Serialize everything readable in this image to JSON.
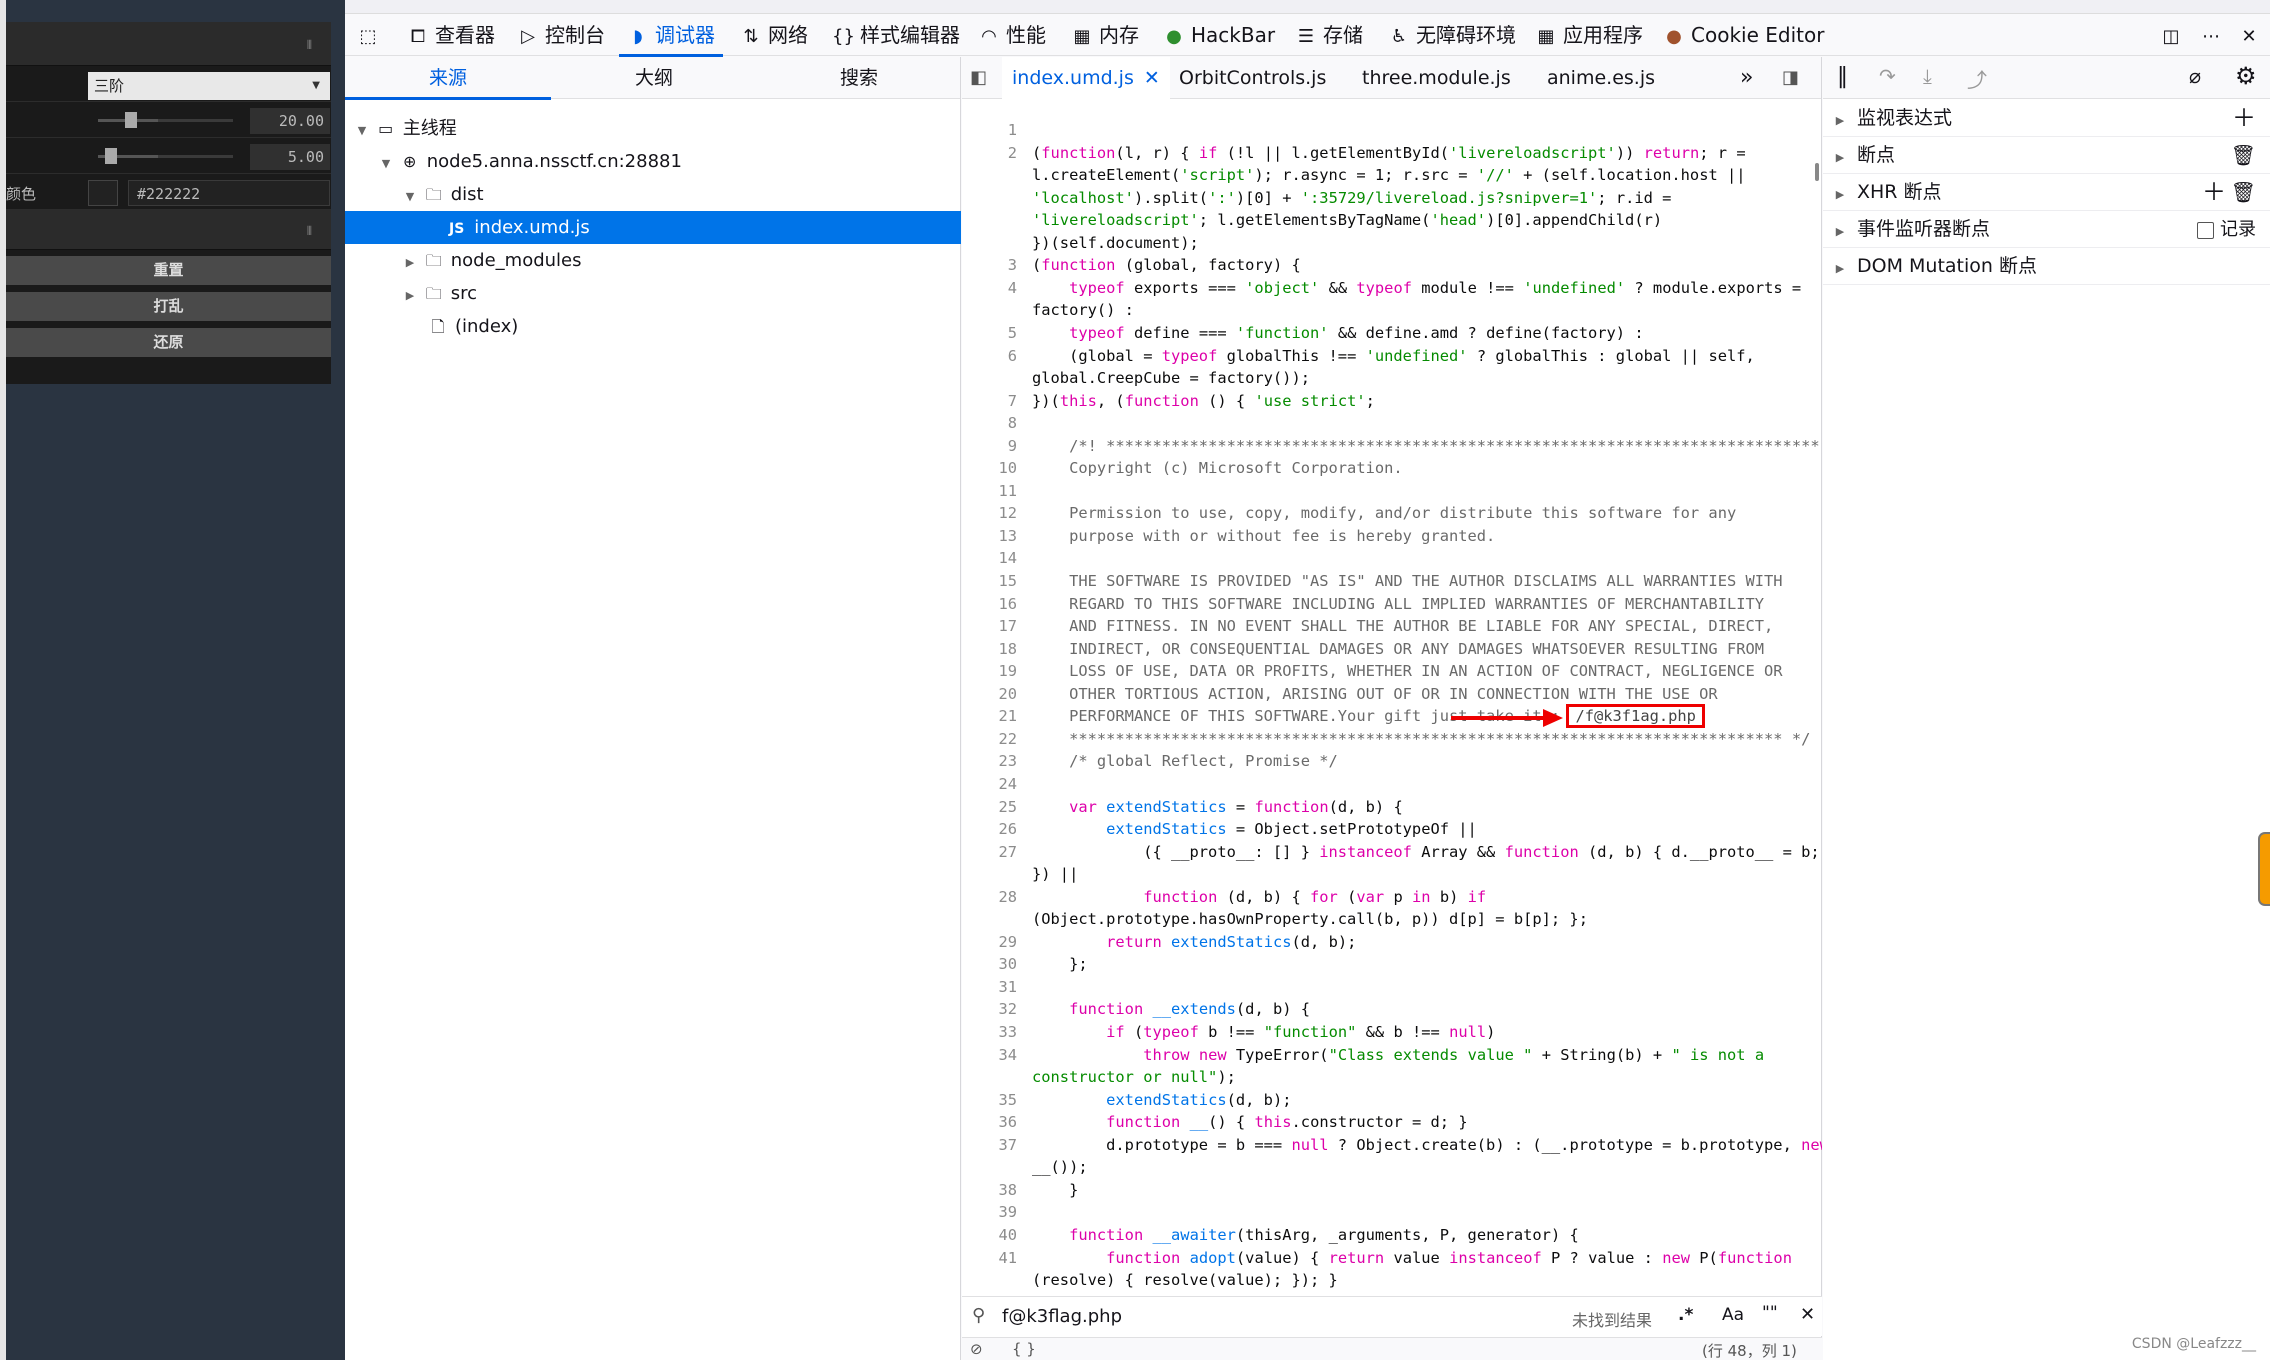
{
  "app": {
    "select_value": "三阶",
    "slider1_value": "20.00",
    "slider1_fraction": 0.2,
    "slider2_value": "5.00",
    "slider2_fraction": 0.05,
    "color_label": "颜色",
    "color_value": "#222222",
    "buttons": [
      "重置",
      "打乱",
      "还原"
    ]
  },
  "toolbar": {
    "items": [
      {
        "label": "查看器",
        "icon": "inspector-icon"
      },
      {
        "label": "控制台",
        "icon": "console-icon"
      },
      {
        "label": "调试器",
        "icon": "debugger-icon"
      },
      {
        "label": "网络",
        "icon": "network-icon"
      },
      {
        "label": "样式编辑器",
        "icon": "style-editor-icon"
      },
      {
        "label": "性能",
        "icon": "performance-icon"
      },
      {
        "label": "内存",
        "icon": "memory-icon"
      },
      {
        "label": "HackBar",
        "icon": "hackbar-icon"
      },
      {
        "label": "存储",
        "icon": "storage-icon"
      },
      {
        "label": "无障碍环境",
        "icon": "accessibility-icon"
      },
      {
        "label": "应用程序",
        "icon": "application-icon"
      },
      {
        "label": "Cookie Editor",
        "icon": "cookie-icon"
      }
    ],
    "active": "调试器"
  },
  "sources": {
    "tabs": [
      "来源",
      "大纲",
      "搜索"
    ],
    "tree": [
      {
        "label": "主线程",
        "level": 0,
        "icon": "window-icon"
      },
      {
        "label": "node5.anna.nssctf.cn:28881",
        "level": 1,
        "icon": "globe-icon"
      },
      {
        "label": "dist",
        "level": 2,
        "icon": "folder-icon"
      },
      {
        "label": "index.umd.js",
        "level": 3,
        "icon": "js-file-icon"
      },
      {
        "label": "node_modules",
        "level": 2,
        "icon": "folder-icon"
      },
      {
        "label": "src",
        "level": 2,
        "icon": "folder-icon"
      },
      {
        "label": "(index)",
        "level": 2,
        "icon": "file-icon"
      }
    ],
    "js_badge": "JS"
  },
  "editor": {
    "tabs": [
      "index.umd.js",
      "OrbitControls.js",
      "three.module.js",
      "anime.es.js"
    ],
    "highlight_text": "/f@k3f1ag.php",
    "search_query": "f@k3flag.php",
    "search_result": "未找到结果",
    "search_opts": [
      ".*",
      "Aa",
      "\"\""
    ],
    "status_left": "{ }",
    "status_right": "(行 48，列 1)"
  },
  "right_panel": {
    "rows": [
      "监视表达式",
      "断点",
      "XHR 断点",
      "事件监听器断点",
      "DOM Mutation 断点"
    ],
    "record_label": "记录"
  },
  "watermark": "CSDN @Leafzzz__"
}
